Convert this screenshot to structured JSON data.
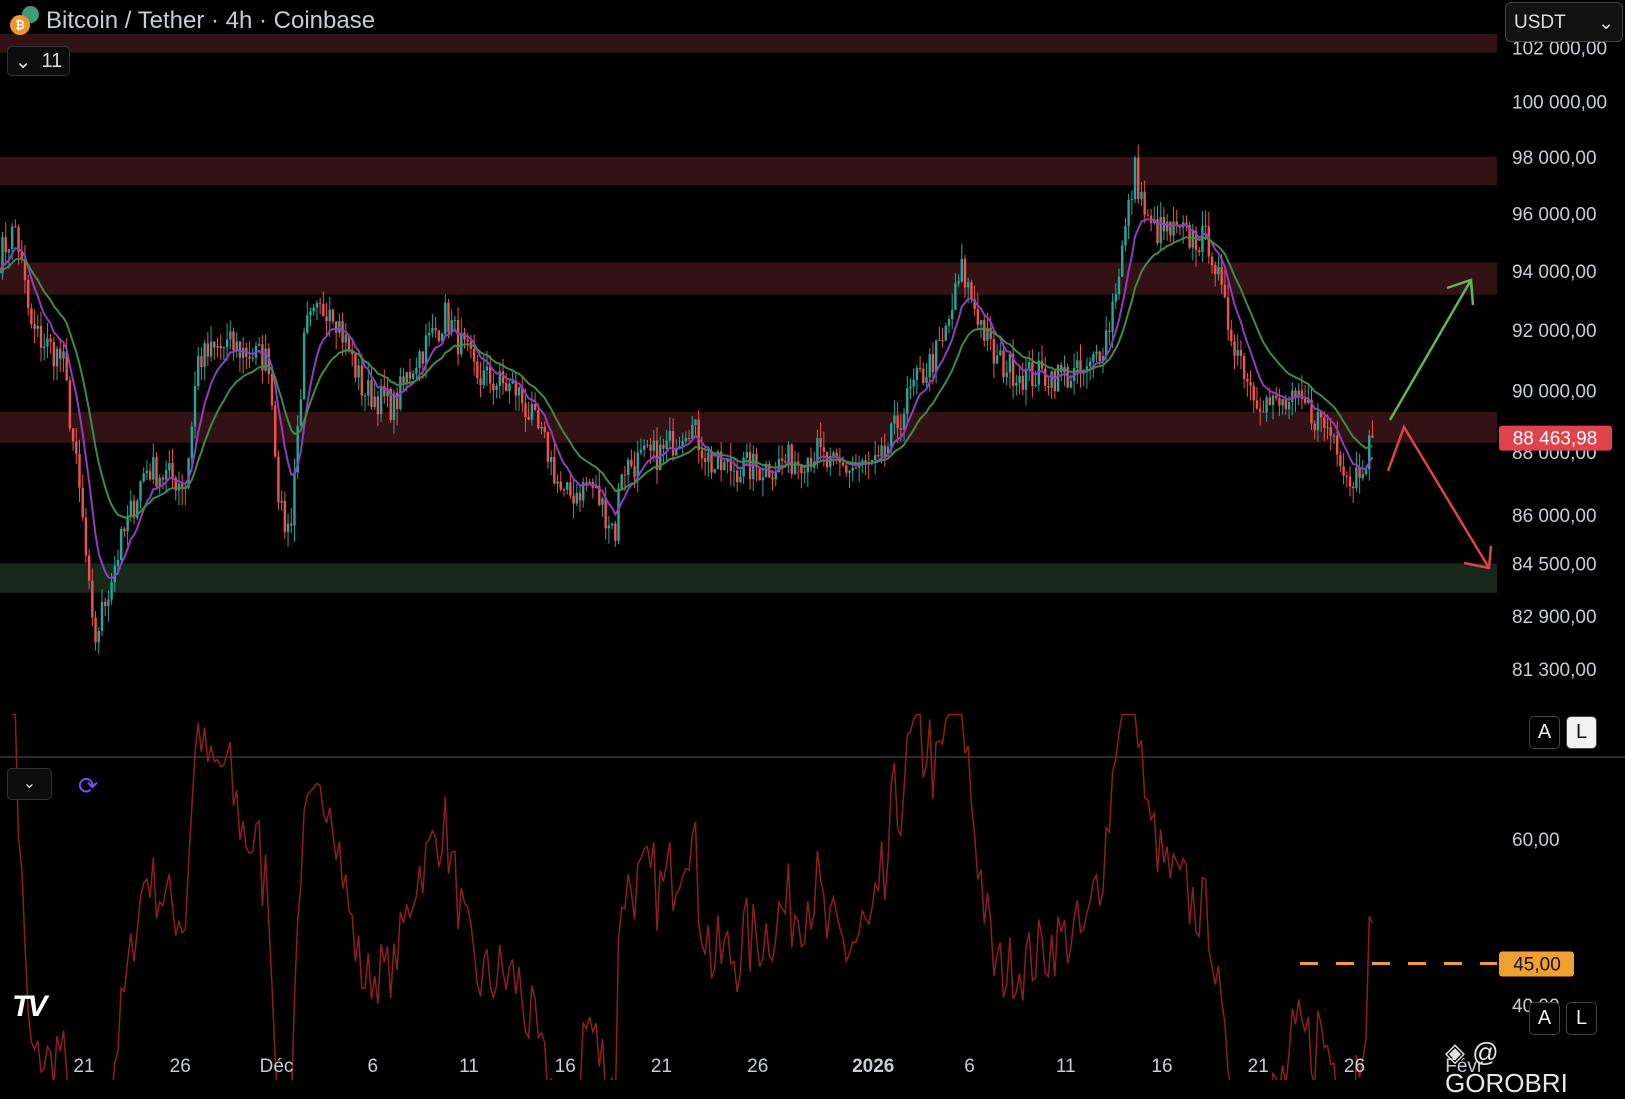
{
  "header": {
    "title": "Bitcoin / Tether · 4h · Coinbase",
    "collapse_count": "11",
    "currency": "USDT"
  },
  "price_axis": {
    "labels": [
      "102 000,00",
      "100 000,00",
      "98 000,00",
      "96 000,00",
      "94 000,00",
      "92 000,00",
      "90 000,00",
      "88 000,00",
      "86 000,00",
      "84 500,00",
      "82 900,00",
      "81 300,00"
    ],
    "last_price": "88 463,98",
    "last_price_color": "#e0424b"
  },
  "indicator_axis": {
    "labels": [
      "60,00",
      "40,00"
    ],
    "level_label": "45,00",
    "level_color": "#f0a030"
  },
  "time_axis": {
    "labels": [
      {
        "day": 4,
        "text": "21"
      },
      {
        "day": 9,
        "text": "26"
      },
      {
        "day": 14,
        "text": "Déc"
      },
      {
        "day": 19,
        "text": "6"
      },
      {
        "day": 24,
        "text": "11"
      },
      {
        "day": 29,
        "text": "16"
      },
      {
        "day": 34,
        "text": "21"
      },
      {
        "day": 39,
        "text": "26"
      },
      {
        "day": 45,
        "text": "2026"
      },
      {
        "day": 50,
        "text": "6"
      },
      {
        "day": 55,
        "text": "11"
      },
      {
        "day": 60,
        "text": "16"
      },
      {
        "day": 65,
        "text": "21"
      },
      {
        "day": 70,
        "text": "26"
      },
      {
        "day": 75.7,
        "text": "Févr"
      }
    ]
  },
  "scale_buttons": {
    "a": "A",
    "l": "L"
  },
  "watermark": "@ GOROBRI",
  "logo": "TV",
  "chart_data": {
    "type": "candlestick",
    "title": "Bitcoin / Tether · 4h · Coinbase",
    "timeframe": "4h",
    "x_unit": "days since 17 Nov",
    "price_scale": "log",
    "ylim": [
      80500,
      102500
    ],
    "close_waypoints": [
      [
        -0.4,
        94500
      ],
      [
        0.45,
        95500
      ],
      [
        1.26,
        92000
      ],
      [
        2.9,
        91000
      ],
      [
        3.9,
        86000
      ],
      [
        4.5,
        82000
      ],
      [
        5.6,
        84500
      ],
      [
        7.2,
        87500
      ],
      [
        9.3,
        87000
      ],
      [
        9.9,
        91000
      ],
      [
        11.5,
        91500
      ],
      [
        13.6,
        91000
      ],
      [
        14.2,
        86000
      ],
      [
        14.7,
        85500
      ],
      [
        15.5,
        92000
      ],
      [
        16.8,
        93000
      ],
      [
        18.5,
        90000
      ],
      [
        20.1,
        89500
      ],
      [
        21.2,
        91000
      ],
      [
        22.8,
        92500
      ],
      [
        24.4,
        90500
      ],
      [
        26.5,
        90000
      ],
      [
        28.1,
        88000
      ],
      [
        28.9,
        86500
      ],
      [
        30.3,
        87000
      ],
      [
        31.6,
        85500
      ],
      [
        31.9,
        87500
      ],
      [
        34.1,
        88000
      ],
      [
        35.4,
        89000
      ],
      [
        36.7,
        87500
      ],
      [
        39.4,
        87500
      ],
      [
        42.1,
        88000
      ],
      [
        42.7,
        87500
      ],
      [
        45.3,
        87500
      ],
      [
        47.0,
        90000
      ],
      [
        48.6,
        91500
      ],
      [
        49.6,
        94000
      ],
      [
        51.3,
        91000
      ],
      [
        52.9,
        90500
      ],
      [
        56.1,
        90500
      ],
      [
        57.2,
        92000
      ],
      [
        58.0,
        95000
      ],
      [
        58.6,
        97500
      ],
      [
        59.3,
        95500
      ],
      [
        62.5,
        95000
      ],
      [
        63.3,
        92500
      ],
      [
        64.7,
        90000
      ],
      [
        65.7,
        89500
      ],
      [
        67.4,
        89500
      ],
      [
        69.0,
        88500
      ],
      [
        69.8,
        87000
      ],
      [
        71.0,
        88464
      ]
    ],
    "zones": [
      {
        "from": 101800,
        "to": 102500,
        "color": "#331215"
      },
      {
        "from": 97000,
        "to": 98000,
        "color": "#331215"
      },
      {
        "from": 93200,
        "to": 94300,
        "color": "#331215"
      },
      {
        "from": 88300,
        "to": 89300,
        "color": "#331215"
      },
      {
        "from": 83600,
        "to": 84500,
        "color": "#15281a"
      }
    ],
    "moving_averages": [
      {
        "name": "EMA fast",
        "period": 9,
        "color": "#8e3fb8"
      },
      {
        "name": "EMA slow",
        "period": 21,
        "color": "#3f8a4a"
      }
    ],
    "indicator": {
      "name": "RSI",
      "period": 14,
      "color": "#8b1f22",
      "ylim": [
        23,
        75
      ],
      "level": 45
    },
    "annotations": [
      {
        "type": "arrow",
        "direction": "up",
        "color": "#5fb55a"
      },
      {
        "type": "arrow",
        "direction": "down",
        "color": "#e0424b"
      }
    ],
    "up_color": "#26a69a",
    "down_color": "#ef5350"
  }
}
